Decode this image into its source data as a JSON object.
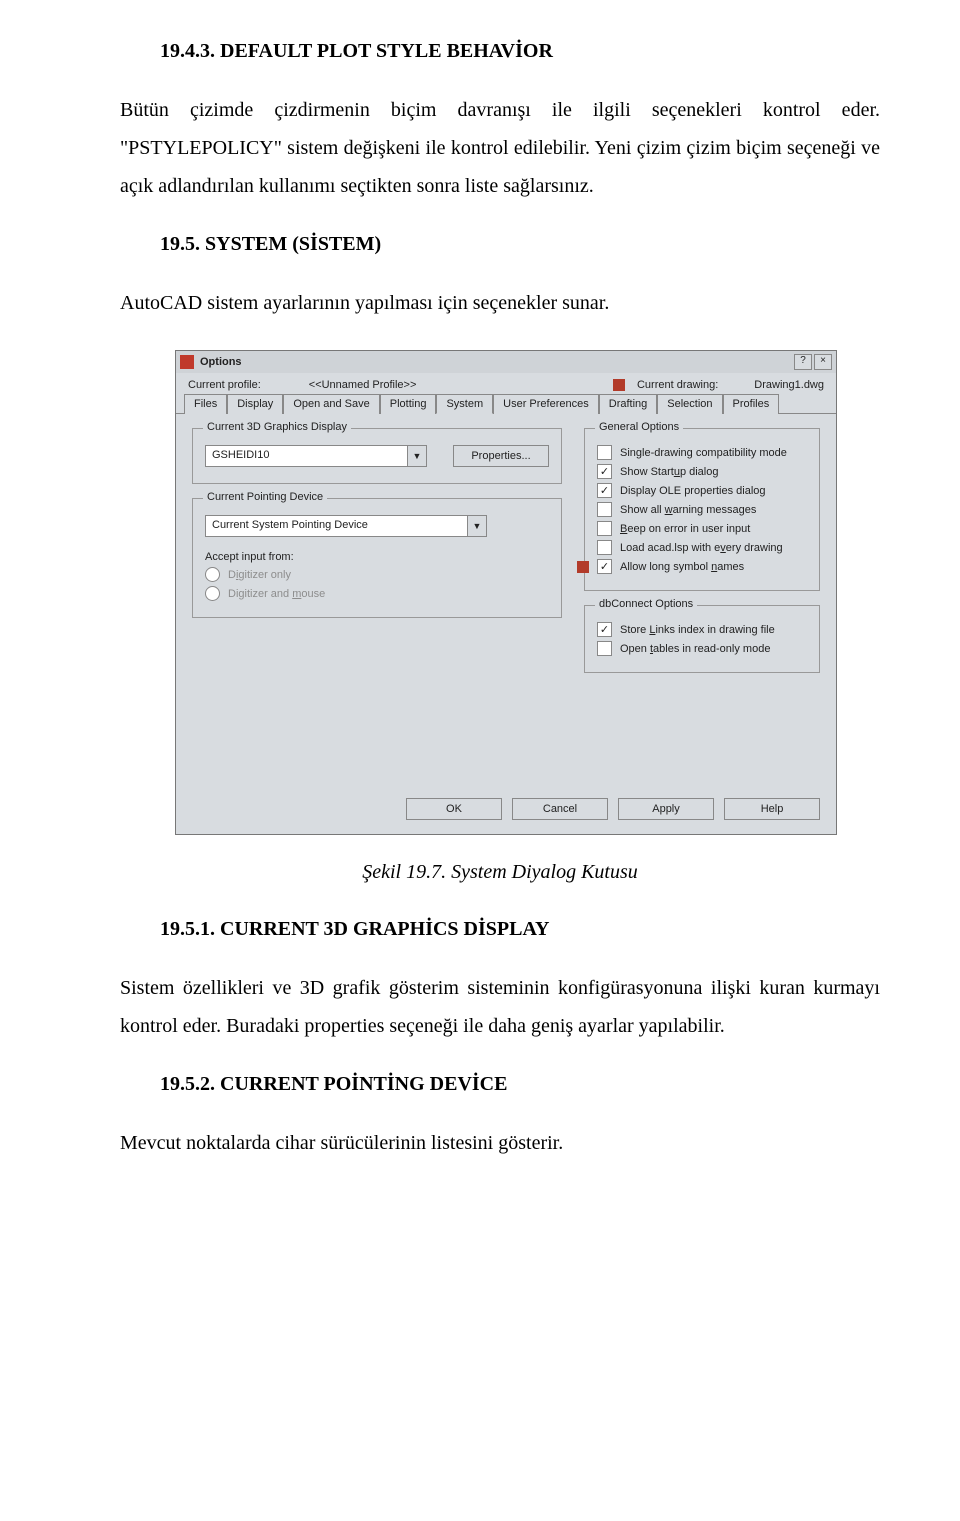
{
  "doc": {
    "h1": "19.4.3. DEFAULT PLOT STYLE BEHAVİOR",
    "p1": "Bütün çizimde çizdirmenin biçim davranışı ile ilgili seçenekleri  kontrol eder. \"PSTYLEPOLICY\" sistem değişkeni ile kontrol edilebilir. Yeni çizim çizim biçim seçeneği ve açık   adlandırılan kullanımı   seçtikten sonra liste sağlarsınız.",
    "h2": "19.5. SYSTEM (SİSTEM)",
    "p2": "AutoCAD sistem ayarlarının yapılması için seçenekler sunar.",
    "figcap": "Şekil 19.7. System Diyalog Kutusu",
    "h3": "19.5.1. CURRENT 3D GRAPHİCS DİSPLAY",
    "p3": "Sistem özellikleri ve 3D grafik gösterim sisteminin konfigürasyonuna  ilişki kuran kurmayı  kontrol eder. Buradaki properties seçeneği ile daha geniş ayarlar yapılabilir.",
    "h4": "19.5.2. CURRENT POİNTİNG DEVİCE",
    "p4": "Mevcut noktalarda cihar sürücülerinin listesini  gösterir."
  },
  "dlg": {
    "title": "Options",
    "help_q": "?",
    "close_x": "×",
    "profile_label": "Current profile:",
    "profile_value": "<<Unnamed Profile>>",
    "drawing_label": "Current drawing:",
    "drawing_value": "Drawing1.dwg",
    "tabs": [
      "Files",
      "Display",
      "Open and Save",
      "Plotting",
      "System",
      "User Preferences",
      "Drafting",
      "Selection",
      "Profiles"
    ],
    "left": {
      "group3d": "Current 3D Graphics Display",
      "driver": "GSHEIDI10",
      "props_btn": "Properties...",
      "groupPoint": "Current Pointing Device",
      "pointing": "Current System Pointing Device",
      "accept": "Accept input from:",
      "r_digonly_pre": "D",
      "r_digonly_mid": "i",
      "r_digonly_post": "gitizer only",
      "r_digmouse_pre": "Digitizer and ",
      "r_digmouse_mid": "m",
      "r_digmouse_post": "ouse"
    },
    "right": {
      "groupGen": "General Options",
      "c_single": "Single-drawing compatibility mode",
      "c_startup_pre": "Show Start",
      "c_startup_mid": "u",
      "c_startup_post": "p dialog",
      "c_ole": "Display OLE properties dialog",
      "c_warn_pre": "Show all ",
      "c_warn_mid": "w",
      "c_warn_post": "arning messages",
      "c_beep_pre": "",
      "c_beep_mid": "B",
      "c_beep_post": "eep on error in user input",
      "c_acad_pre": "Load acad.lsp with e",
      "c_acad_mid": "v",
      "c_acad_post": "ery drawing",
      "c_long_pre": "Allow long symbol ",
      "c_long_mid": "n",
      "c_long_post": "ames",
      "groupDb": "dbConnect Options",
      "c_store_pre": "Store ",
      "c_store_mid": "L",
      "c_store_post": "inks index in drawing file",
      "c_open_pre": "Open ",
      "c_open_mid": "t",
      "c_open_post": "ables in read-only mode"
    },
    "footer": {
      "ok": "OK",
      "cancel": "Cancel",
      "apply": "Apply",
      "help": "Help"
    }
  }
}
